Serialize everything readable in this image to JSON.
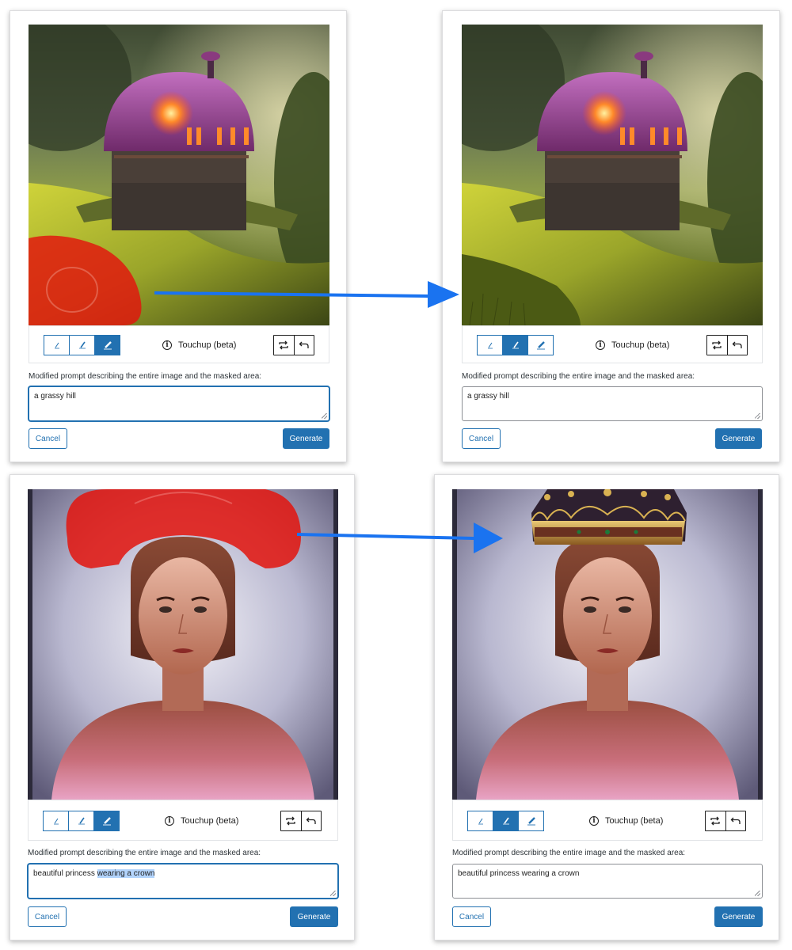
{
  "toolbar": {
    "touchup_label": "Touchup (beta)"
  },
  "panels": [
    {
      "id": "top-left",
      "prompt_label": "Modified prompt describing the entire image and the masked area:",
      "prompt_value": "a grassy hill",
      "cancel_label": "Cancel",
      "generate_label": "Generate",
      "active_brush": 3,
      "mask_visible": true,
      "subject": "house"
    },
    {
      "id": "top-right",
      "prompt_label": "Modified prompt describing the entire image and the masked area:",
      "prompt_value": "a grassy hill",
      "cancel_label": "Cancel",
      "generate_label": "Generate",
      "active_brush": 2,
      "mask_visible": false,
      "subject": "house"
    },
    {
      "id": "bottom-left",
      "prompt_label": "Modified prompt describing the entire image and the masked area:",
      "prompt_value_plain": "beautiful princess ",
      "prompt_value_selected": "wearing a crown",
      "cancel_label": "Cancel",
      "generate_label": "Generate",
      "active_brush": 3,
      "mask_visible": true,
      "subject": "portrait"
    },
    {
      "id": "bottom-right",
      "prompt_label": "Modified prompt describing the entire image and the masked area:",
      "prompt_value": "beautiful princess wearing a crown",
      "cancel_label": "Cancel",
      "generate_label": "Generate",
      "active_brush": 2,
      "mask_visible": false,
      "subject": "portrait-crown"
    }
  ],
  "icons": {
    "brushes": [
      "brush-small-icon",
      "brush-medium-icon",
      "brush-large-icon"
    ],
    "info": "info-icon",
    "regenerate": "regenerate-icon",
    "undo": "undo-icon",
    "arrow": "arrow-icon"
  },
  "colors": {
    "accent": "#2271b1",
    "mask": "#e32016",
    "arrow": "#1a73f0"
  }
}
